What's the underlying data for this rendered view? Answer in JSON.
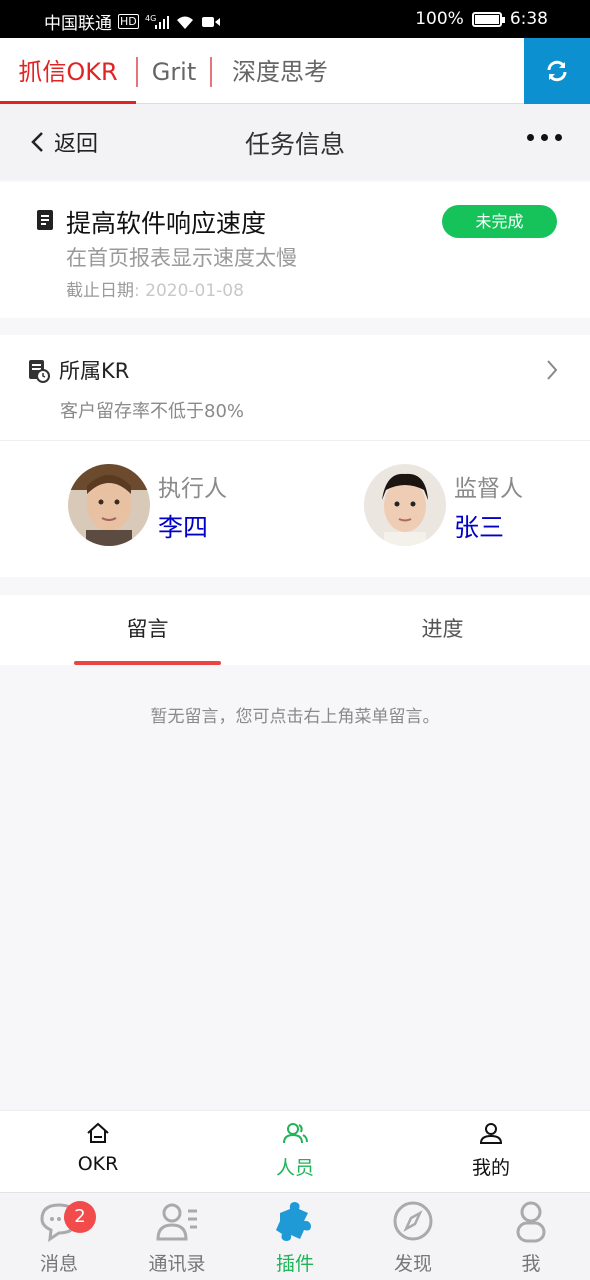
{
  "status_bar": {
    "carrier": "中国联通",
    "network": "4G",
    "battery": "100%",
    "battery_level": 1.0,
    "time": "6:38"
  },
  "top_tabs": [
    "抓信OKR",
    "Grit",
    "深度思考"
  ],
  "nav": {
    "back_label": "返回",
    "title": "任务信息"
  },
  "task": {
    "title": "提高软件响应速度",
    "description": "在首页报表显示速度太慢",
    "deadline_label": "截止日期",
    "deadline_sep": ":",
    "deadline": "2020-01-08",
    "status": "未完成",
    "status_color": "#15c35a"
  },
  "kr": {
    "section_label": "所属KR",
    "text": "客户留存率不低于80%"
  },
  "people": {
    "executor_role": "执行人",
    "executor_name": "李四",
    "supervisor_role": "监督人",
    "supervisor_name": "张三"
  },
  "sub_tabs": {
    "comments": "留言",
    "progress": "进度"
  },
  "empty_message": "暂无留言，您可点击右上角菜单留言。",
  "inner_nav": [
    "OKR",
    "人员",
    "我的"
  ],
  "app_bar": {
    "items": [
      "消息",
      "通讯录",
      "插件",
      "发现",
      "我"
    ],
    "message_badge": "2"
  },
  "colors": {
    "accent_red": "#e02424",
    "active_green": "#21b35a",
    "refresh_blue": "#0d90cf",
    "link_blue": "#0000c8"
  }
}
